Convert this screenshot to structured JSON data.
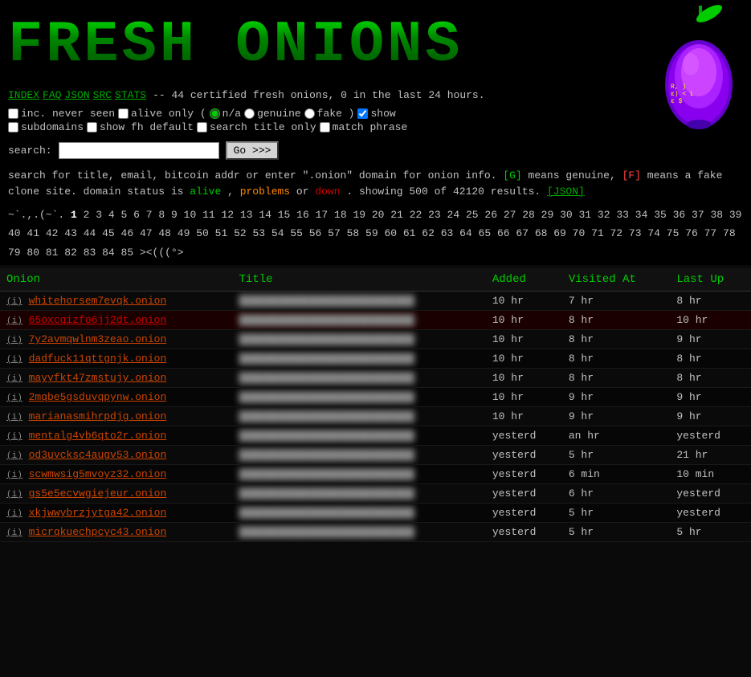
{
  "header": {
    "logo": "FRESH ONIONS",
    "nav": {
      "index": "INDEX",
      "faq": "FAQ",
      "json": "JSON",
      "src": "SRC",
      "stats": "STATS",
      "info": "-- 44 certified fresh onions, 0 in the last 24 hours."
    }
  },
  "options": {
    "inc_never_seen_label": "inc. never seen",
    "alive_only_label": "alive only (",
    "na_label": "n/a",
    "genuine_label": "genuine",
    "fake_label": "fake )",
    "show_label": "show",
    "subdomains_label": "subdomains",
    "show_fh_label": "show fh default",
    "search_title_label": "search title only",
    "match_phrase_label": "match phrase"
  },
  "search": {
    "label": "search:",
    "placeholder": "",
    "button": "Go >>>"
  },
  "info": {
    "line1": "search for title, email, bitcoin addr or enter \".onion\" domain for onion info.",
    "genuine_badge": "[G]",
    "genuine_note": "means genuine,",
    "fake_badge": "[F]",
    "fake_note": "means a fake",
    "line2": "clone site. domain status is",
    "alive": "alive",
    "problems": "problems",
    "or": "or",
    "down": "down",
    "line3": ". showing 500 of 42120 results.",
    "json_link": "[JSON]"
  },
  "pagination": {
    "tilde": "~`.,.(~`.",
    "current_page": "1",
    "pages": [
      "2",
      "3",
      "4",
      "5",
      "6",
      "7",
      "8",
      "9",
      "10",
      "11",
      "12",
      "13",
      "14",
      "15",
      "16",
      "17",
      "18",
      "19",
      "20",
      "21",
      "22",
      "23",
      "24",
      "25",
      "26",
      "27",
      "28",
      "29",
      "30",
      "31",
      "32",
      "33",
      "34",
      "35",
      "36",
      "37",
      "38",
      "39",
      "40",
      "41",
      "42",
      "43",
      "44",
      "45",
      "46",
      "47",
      "48",
      "49",
      "50",
      "51",
      "52",
      "53",
      "54",
      "55",
      "56",
      "57",
      "58",
      "59",
      "60",
      "61",
      "62",
      "63",
      "64",
      "65",
      "66",
      "67",
      "68",
      "69",
      "70",
      "71",
      "72",
      "73",
      "74",
      "75",
      "76",
      "77",
      "78",
      "79",
      "80",
      "81",
      "82",
      "83",
      "84",
      "85"
    ],
    "special": "><(((°>"
  },
  "table": {
    "headers": {
      "onion": "Onion",
      "title": "Title",
      "added": "Added",
      "visited": "Visited At",
      "last_up": "Last Up"
    },
    "rows": [
      {
        "info": "(i)",
        "onion": "whitehorsem7evqk.onion",
        "title_blurred": true,
        "added": "10 hr",
        "visited": "7 hr",
        "last_up": "8 hr",
        "fake": false
      },
      {
        "info": "(i)",
        "onion": "65oxcqizfo6jj2dt.onion",
        "title_blurred": true,
        "added": "10 hr",
        "visited": "8 hr",
        "last_up": "10 hr",
        "fake": true
      },
      {
        "info": "(i)",
        "onion": "7y2avmqwlnm3zeao.onion",
        "title_blurred": true,
        "added": "10 hr",
        "visited": "8 hr",
        "last_up": "9 hr",
        "fake": false
      },
      {
        "info": "(i)",
        "onion": "dadfuck11qttgnjk.onion",
        "title_blurred": true,
        "added": "10 hr",
        "visited": "8 hr",
        "last_up": "8 hr",
        "fake": false
      },
      {
        "info": "(i)",
        "onion": "mayyfkt47zmstujy.onion",
        "title_blurred": true,
        "added": "10 hr",
        "visited": "8 hr",
        "last_up": "8 hr",
        "fake": false
      },
      {
        "info": "(i)",
        "onion": "2mqbe5gsduvqpynw.onion",
        "title_blurred": true,
        "added": "10 hr",
        "visited": "9 hr",
        "last_up": "9 hr",
        "fake": false
      },
      {
        "info": "(i)",
        "onion": "marianasmihrpdjg.onion",
        "title_blurred": true,
        "added": "10 hr",
        "visited": "9 hr",
        "last_up": "9 hr",
        "fake": false
      },
      {
        "info": "(i)",
        "onion": "mentalg4vb6qto2r.onion",
        "title_blurred": true,
        "added": "yesterd",
        "visited": "an hr",
        "last_up": "yesterd",
        "fake": false
      },
      {
        "info": "(i)",
        "onion": "od3uvcksc4augv53.onion",
        "title_blurred": true,
        "added": "yesterd",
        "visited": "5 hr",
        "last_up": "21 hr",
        "fake": false
      },
      {
        "info": "(i)",
        "onion": "scwmwsig5mvoyz32.onion",
        "title_blurred": true,
        "added": "yesterd",
        "visited": "6 min",
        "last_up": "10 min",
        "fake": false
      },
      {
        "info": "(i)",
        "onion": "gs5e5ecvwgiejeur.onion",
        "title_blurred": true,
        "added": "yesterd",
        "visited": "6 hr",
        "last_up": "yesterd",
        "fake": false
      },
      {
        "info": "(i)",
        "onion": "xkjwwybrzjytga42.onion",
        "title_blurred": true,
        "added": "yesterd",
        "visited": "5 hr",
        "last_up": "yesterd",
        "fake": false
      },
      {
        "info": "(i)",
        "onion": "micrqkuechpcyc43.onion",
        "title_blurred": true,
        "added": "yesterd",
        "visited": "5 hr",
        "last_up": "5 hr",
        "fake": false
      }
    ],
    "title_placeholder": "████████████████████"
  }
}
